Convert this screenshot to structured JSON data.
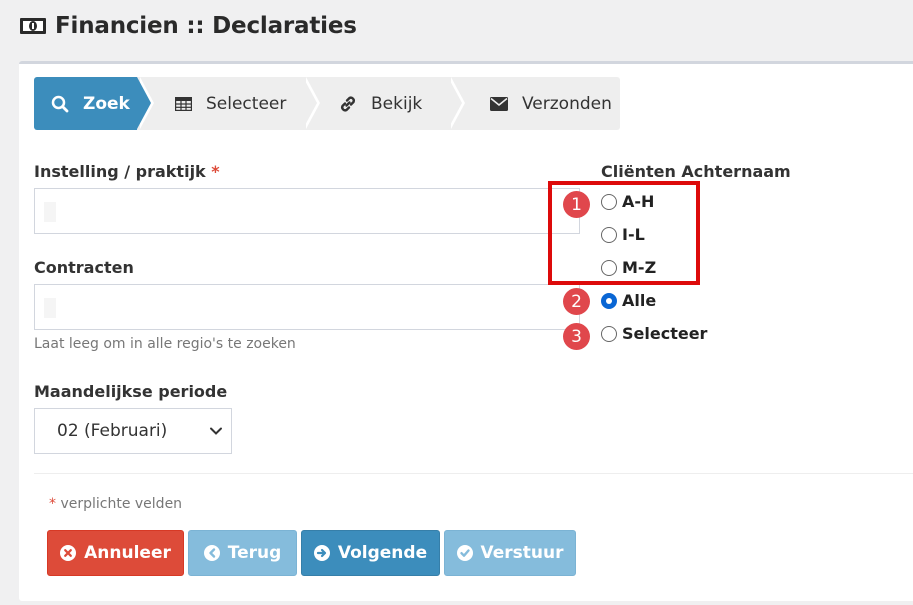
{
  "page": {
    "title": "Financien :: Declaraties"
  },
  "wizard": {
    "steps": [
      {
        "label": "Zoek",
        "icon": "search-icon",
        "active": true
      },
      {
        "label": "Selecteer",
        "icon": "table-icon",
        "active": false
      },
      {
        "label": "Bekijk",
        "icon": "link-icon",
        "active": false
      },
      {
        "label": "Verzonden",
        "icon": "envelope-icon",
        "active": false
      }
    ]
  },
  "form": {
    "institution_label": "Instelling / praktijk",
    "institution_required": "*",
    "institution_value": "",
    "contracts_label": "Contracten",
    "contracts_value": "",
    "contracts_help": "Laat leeg om in alle regio's te zoeken",
    "period_label": "Maandelijkse periode",
    "period_value": "02 (Februari)",
    "client_label": "Cliënten Achternaam",
    "client_options": [
      {
        "label": "A-H",
        "checked": false
      },
      {
        "label": "I-L",
        "checked": false
      },
      {
        "label": "M-Z",
        "checked": false
      },
      {
        "label": "Alle",
        "checked": true
      },
      {
        "label": "Selecteer",
        "checked": false
      }
    ],
    "required_star": "*",
    "required_note": "verplichte velden"
  },
  "annotations": {
    "badges": [
      "1",
      "2",
      "3"
    ]
  },
  "buttons": {
    "cancel": "Annuleer",
    "back": "Terug",
    "next": "Volgende",
    "send": "Verstuur"
  },
  "colors": {
    "primary": "#3c8dbc",
    "danger": "#dd4b39",
    "muted": "#85bcdc",
    "highlight": "#dd0a0a",
    "badge": "#e0474c"
  }
}
